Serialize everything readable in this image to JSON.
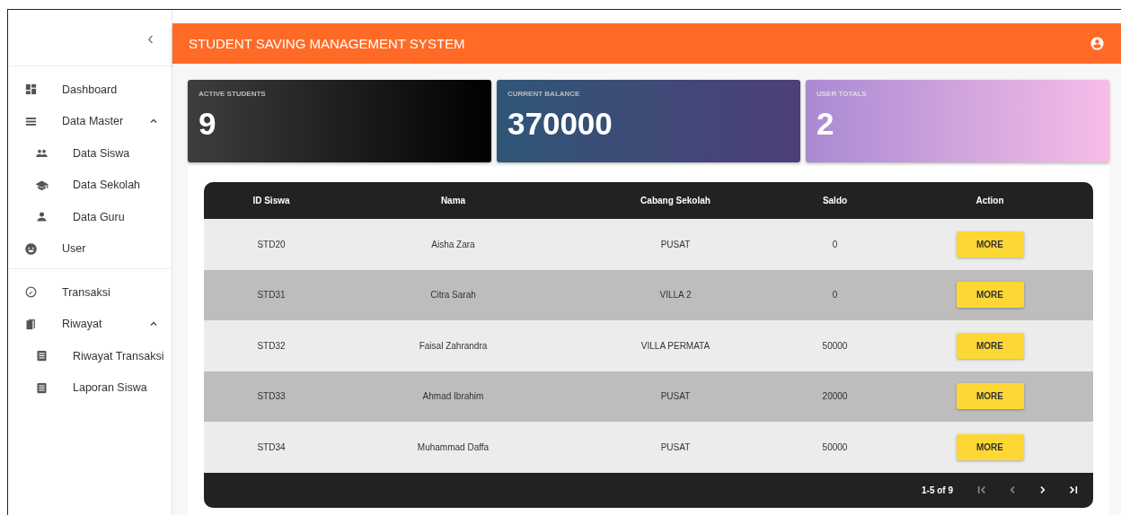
{
  "sidebar": {
    "collapse_icon": "‹",
    "groups": [
      {
        "items": [
          {
            "label": "Dashboard",
            "kind": "dashboard"
          },
          {
            "label": "Data Master",
            "kind": "list",
            "expanded": true,
            "children": [
              {
                "label": "Data Siswa",
                "kind": "people"
              },
              {
                "label": "Data Sekolah",
                "kind": "school"
              },
              {
                "label": "Data Guru",
                "kind": "person"
              }
            ]
          },
          {
            "label": "User",
            "kind": "user"
          }
        ]
      },
      {
        "items": [
          {
            "label": "Transaksi",
            "kind": "speed"
          },
          {
            "label": "Riwayat",
            "kind": "book",
            "expanded": true,
            "children": [
              {
                "label": "Riwayat Transaksi",
                "kind": "doc"
              },
              {
                "label": "Laporan Siswa",
                "kind": "doc"
              }
            ]
          }
        ]
      }
    ]
  },
  "header": {
    "title": "STUDENT SAVING MANAGEMENT SYSTEM"
  },
  "stats": [
    {
      "label": "ACTIVE STUDENTS",
      "value": "9",
      "kind": "dark"
    },
    {
      "label": "CURRENT BALANCE",
      "value": "370000",
      "kind": "blue"
    },
    {
      "label": "USER TOTALS",
      "value": "2",
      "kind": "pink"
    }
  ],
  "table": {
    "columns": [
      "ID Siswa",
      "Nama",
      "Cabang Sekolah",
      "Saldo",
      "Action"
    ],
    "rows": [
      {
        "cells": [
          "STD20",
          "Aisha Zara",
          "PUSAT",
          "0"
        ],
        "action": "MORE"
      },
      {
        "cells": [
          "STD31",
          "Citra Sarah",
          "VILLA 2",
          "0"
        ],
        "action": "MORE"
      },
      {
        "cells": [
          "STD32",
          "Faisal Zahrandra",
          "VILLA PERMATA",
          "50000"
        ],
        "action": "MORE"
      },
      {
        "cells": [
          "STD33",
          "Ahmad Ibrahim",
          "PUSAT",
          "20000"
        ],
        "action": "MORE"
      },
      {
        "cells": [
          "STD34",
          "Muhammad Daffa",
          "PUSAT",
          "50000"
        ],
        "action": "MORE"
      }
    ],
    "pagination": {
      "range": "1-5 of 9",
      "buttons": [
        {
          "kind": "first",
          "disabled": true
        },
        {
          "kind": "prev",
          "disabled": true
        },
        {
          "kind": "next",
          "disabled": false
        },
        {
          "kind": "last",
          "disabled": false
        }
      ]
    }
  }
}
